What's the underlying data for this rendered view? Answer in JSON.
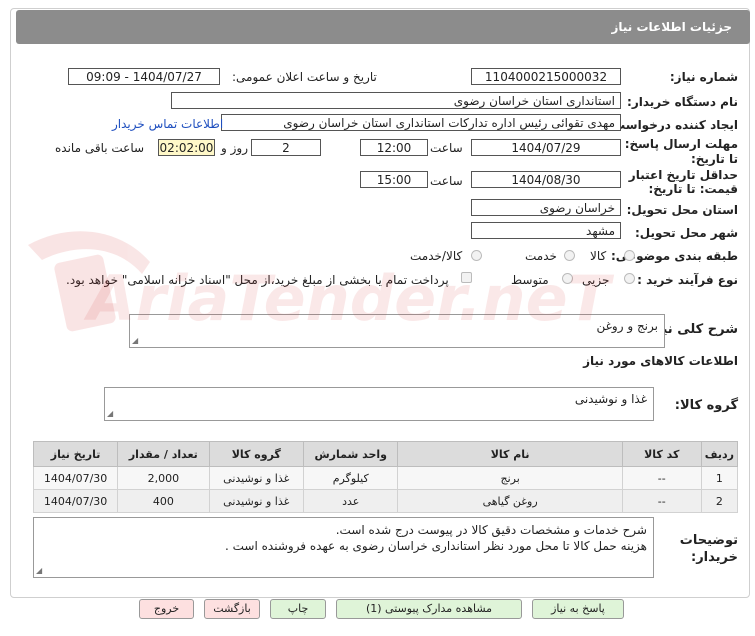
{
  "header": {
    "title": "جزئیات اطلاعات نیاز"
  },
  "labels": {
    "need_number": "شماره نیاز:",
    "announce_datetime": "تاریخ و ساعت اعلان عمومی:",
    "buyer_org": "نام دستگاه خریدار:",
    "requester": "ایجاد کننده درخواست:",
    "reply_deadline": "مهلت ارسال پاسخ: تا تاریخ:",
    "time": "ساعت",
    "day_and": "روز و",
    "remaining": "ساعت باقی مانده",
    "validity": "حداقل تاریخ اعتبار قیمت: تا تاریخ:",
    "province": "استان محل تحویل:",
    "city": "شهر محل تحویل:",
    "category": "طبقه بندی موضوعی:",
    "process_type": "نوع فرآیند خرید :",
    "general_desc": "شرح کلی نیاز:",
    "goods_info": "اطلاعات کالاهای مورد نیاز",
    "goods_group": "گروه کالا:",
    "buyer_notes": "توضیحات خریدار:"
  },
  "values": {
    "need_number": "1104000215000032",
    "announce_datetime": "1404/07/27 - 09:09",
    "buyer_org": "استانداری استان خراسان رضوی",
    "requester": "مهدی تقوائی رئیس اداره تدارکات استانداری استان خراسان رضوی",
    "contact_link": "اطلاعات تماس خریدار",
    "reply_date": "1404/07/29",
    "reply_time": "12:00",
    "reply_days": "2",
    "remaining_time": "02:02:00",
    "validity_date": "1404/08/30",
    "validity_time": "15:00",
    "province": "خراسان رضوی",
    "city": "مشهد",
    "general_desc": "برنج و روغن",
    "goods_group": "غذا و نوشیدنی",
    "notes_line1": "شرح خدمات و مشخصات دقیق  کالا در پیوست درج شده است.",
    "notes_line2": "هزینه حمل کالا تا محل مورد نظر استانداری خراسان رضوی به عهده فروشنده است ."
  },
  "category_options": [
    "کالا",
    "خدمت",
    "کالا/خدمت"
  ],
  "process_options": [
    "جزیی",
    "متوسط"
  ],
  "payment_note": "پرداخت تمام یا بخشی از مبلغ خرید،از محل \"اسناد خزانه اسلامی\" خواهد بود.",
  "table": {
    "headers": [
      "ردیف",
      "کد کالا",
      "نام کالا",
      "واحد شمارش",
      "گروه کالا",
      "تعداد / مقدار",
      "تاریخ نیاز"
    ],
    "rows": [
      [
        "1",
        "--",
        "برنج",
        "کیلوگرم",
        "غذا و نوشیدنی",
        "2,000",
        "1404/07/30"
      ],
      [
        "2",
        "--",
        "روغن گیاهی",
        "عدد",
        "غذا و نوشیدنی",
        "400",
        "1404/07/30"
      ]
    ]
  },
  "buttons": {
    "reply": "پاسخ به نیاز",
    "attachments": "مشاهده مدارک پیوستی (1)",
    "print": "چاپ",
    "back": "بازگشت",
    "exit": "خروج"
  },
  "watermark": {
    "text": "AriaTender.neT"
  },
  "colors": {
    "header_bg": "#8c8c8c",
    "link": "#1f4fbf",
    "green_button": "#dff4d8",
    "red_button": "#fde0e0",
    "remaining_bg": "#fff8c8"
  }
}
